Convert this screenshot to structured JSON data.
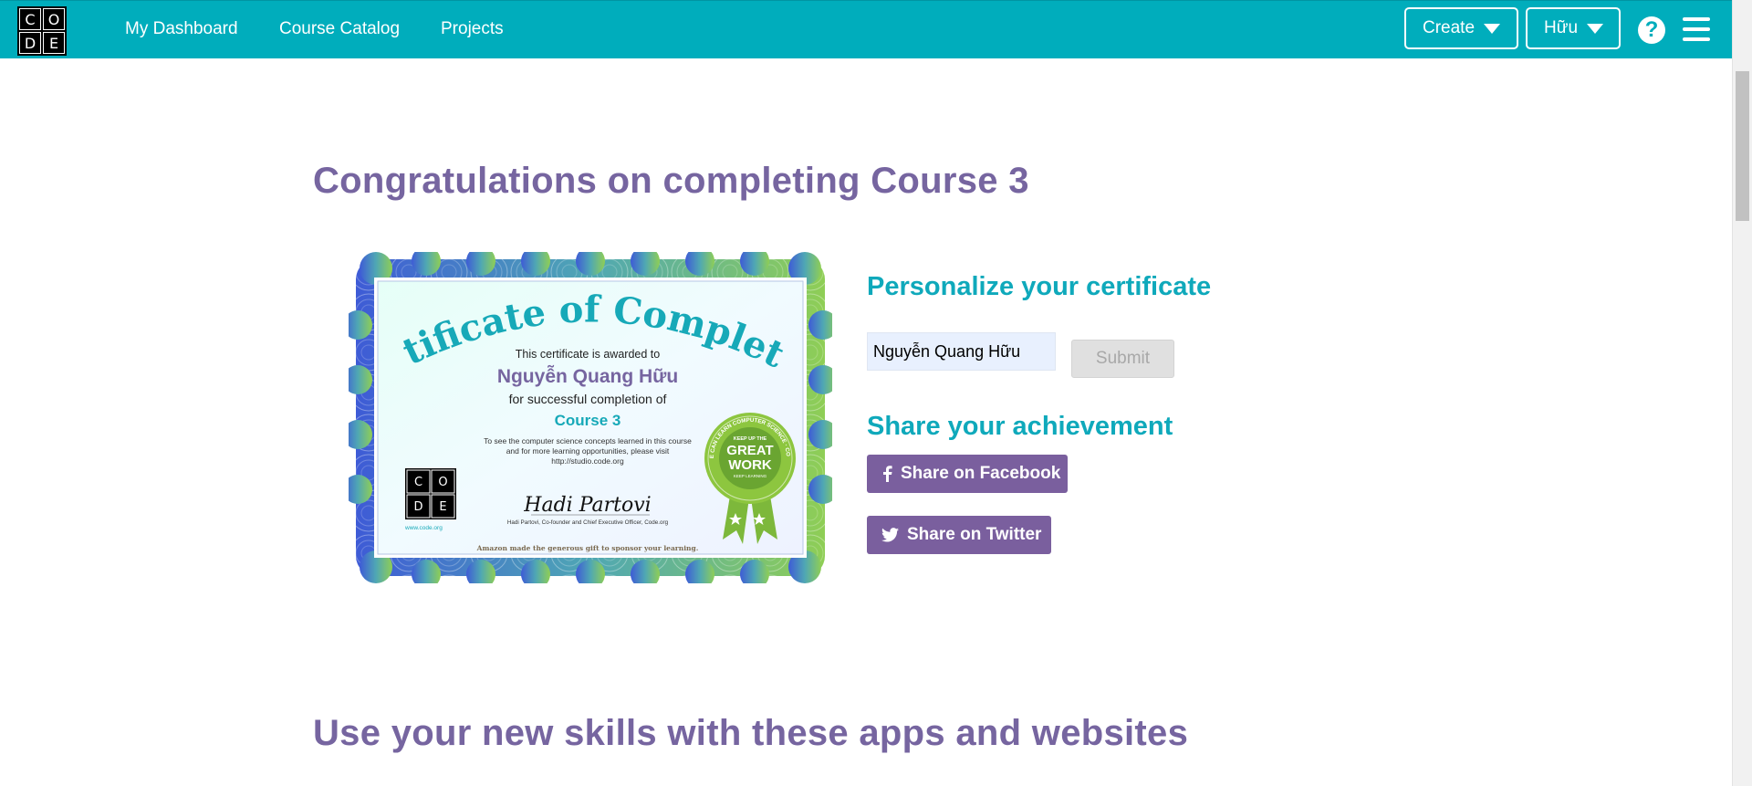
{
  "header": {
    "logo_letters": [
      "C",
      "O",
      "D",
      "E"
    ],
    "nav": [
      "My Dashboard",
      "Course Catalog",
      "Projects"
    ],
    "create_label": "Create",
    "user_label": "Hữu",
    "help_glyph": "?",
    "icons": [
      "caret-down-icon",
      "help-icon",
      "hamburger-menu-icon"
    ],
    "background_color": "#00adbc"
  },
  "main": {
    "heading": "Congratulations on completing Course 3",
    "heading_color": "#7665a0",
    "certificate": {
      "title": "Certificate of Completion",
      "awarded_text": "This certificate is awarded to",
      "name": "Nguyễn Quang Hữu",
      "completion_text": "for successful completion of",
      "course": "Course 3",
      "info_line1": "To see the computer science concepts learned in this course",
      "info_line2": "and for more learning opportunities, please visit",
      "info_url": "http://studio.code.org",
      "logo_letters": [
        "C",
        "O",
        "D",
        "E"
      ],
      "website": "www.code.org",
      "signer": "Hadi Partovi, Co-founder and Chief Executive Officer, Code.org",
      "signature": "Hadi Partovi",
      "sponsor": "Amazon made the generous gift to sponsor your learning.",
      "badge_top": "KEEP UP THE",
      "badge_main1": "GREAT",
      "badge_main2": "WORK",
      "badge_sub": "KEEP LEARNING",
      "badge_ring": "ANYONE CAN LEARN COMPUTER SCIENCE · CODE.ORG"
    },
    "personalize": {
      "title": "Personalize your certificate",
      "input_value": "Nguyễn Quang Hữu",
      "submit_label": "Submit"
    },
    "share": {
      "title": "Share your achievement",
      "facebook_label": "Share on Facebook",
      "twitter_label": "Share on Twitter",
      "button_color": "#7a5f9e"
    },
    "section2_heading": "Use your new skills with these apps and websites"
  }
}
